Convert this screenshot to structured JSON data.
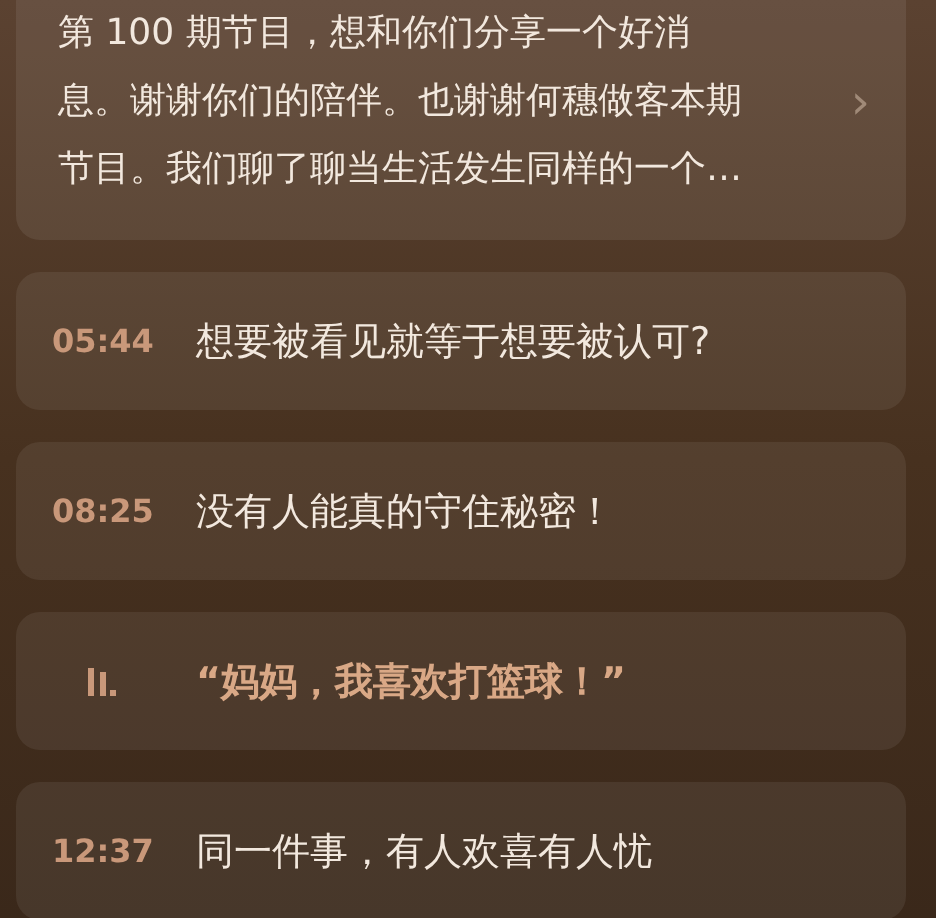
{
  "summary": {
    "lines": [
      "第 100 期节目，想和你们分享一个好消",
      "息。谢谢你们的陪伴。也谢谢何穗做客本期",
      "节目。我们聊了聊当生活发生同样的一个…"
    ],
    "chevron": "›"
  },
  "chapters": [
    {
      "time": "05:44",
      "title": "想要被看见就等于想要被认可?",
      "playing": false
    },
    {
      "time": "08:25",
      "title": "没有人能真的守住秘密！",
      "playing": false
    },
    {
      "title": "“妈妈，我喜欢打篮球！”",
      "playing": true
    },
    {
      "time": "12:37",
      "title": "同一件事，有人欢喜有人忧",
      "playing": false
    }
  ]
}
